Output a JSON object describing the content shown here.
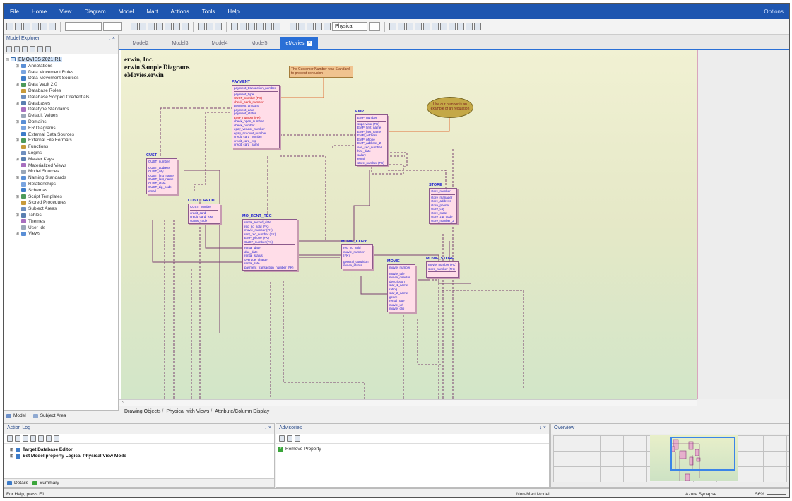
{
  "menu": [
    "File",
    "Home",
    "View",
    "Diagram",
    "Model",
    "Mart",
    "Actions",
    "Tools",
    "Help"
  ],
  "menu_right": "Options",
  "toolbar": {
    "notation_combo": "Physical"
  },
  "explorer": {
    "title": "Model Explorer",
    "root": "EMOVIES 2021 R1",
    "items": [
      "Annotations",
      "Data Movement Rules",
      "Data Movement Sources",
      "Data Vault 2.0",
      "Database Roles",
      "Database Scoped Credentials",
      "Databases",
      "Datatype Standards",
      "Default Values",
      "Domains",
      "ER Diagrams",
      "External Data Sources",
      "External File Formats",
      "Functions",
      "Logins",
      "Master Keys",
      "Materialized Views",
      "Model Sources",
      "Naming Standards",
      "Relationships",
      "Schemas",
      "Script Templates",
      "Stored Procedures",
      "Subject Areas",
      "Tables",
      "Themes",
      "User Ids",
      "Views"
    ],
    "tabs": [
      "Model",
      "Subject Area"
    ]
  },
  "doc_tabs": [
    "Model2",
    "Model3",
    "Model4",
    "Model5",
    "eMovies"
  ],
  "diagram": {
    "header": [
      "erwin, Inc.",
      "erwin Sample Diagrams",
      "eMovies.erwin"
    ],
    "note1": "The Customer Number was Standard to prevent confusion",
    "note2": "Use our number is an example of an regulation",
    "entities": [
      {
        "name": "PAYMENT",
        "pk": [
          "payment_transaction_number"
        ],
        "attrs": [
          {
            "t": "payment_type",
            "c": "b"
          },
          {
            "t": "CUST_number (FK)",
            "c": "r"
          },
          {
            "t": "check_bank_number",
            "c": "r"
          },
          {
            "t": "payment_amount",
            "c": "b"
          },
          {
            "t": "payment_date",
            "c": "b"
          },
          {
            "t": "payment_status",
            "c": "b"
          },
          {
            "t": "EMP_number (FK)",
            "c": "r"
          },
          {
            "t": "check_open_number",
            "c": "b"
          },
          {
            "t": "check_number",
            "c": "b"
          },
          {
            "t": "epay_vendor_number",
            "c": "b"
          },
          {
            "t": "epay_account_number",
            "c": "b"
          },
          {
            "t": "credit_card_number",
            "c": "b"
          },
          {
            "t": "credit_card_exp",
            "c": "b"
          },
          {
            "t": "credit_card_name",
            "c": "b"
          }
        ]
      },
      {
        "name": "EMP",
        "pk": [
          "EMP_number"
        ],
        "attrs": [
          {
            "t": "supervisor (FK)",
            "c": "b"
          },
          {
            "t": "EMP_first_name",
            "c": "b"
          },
          {
            "t": "EMP_last_name",
            "c": "b"
          },
          {
            "t": "EMP_address",
            "c": "b"
          },
          {
            "t": "EMP_phone",
            "c": "b"
          },
          {
            "t": "EMP_address_2",
            "c": "b"
          },
          {
            "t": "soc_sec_number",
            "c": "b"
          },
          {
            "t": "hire_date",
            "c": "b"
          },
          {
            "t": "salary",
            "c": "b"
          },
          {
            "t": "email",
            "c": "b"
          },
          {
            "t": "store_number (FK)",
            "c": "b"
          }
        ]
      },
      {
        "name": "CUST",
        "pk": [
          "CUST_number"
        ],
        "attrs": [
          {
            "t": "CUST_address",
            "c": "b"
          },
          {
            "t": "CUST_city",
            "c": "b"
          },
          {
            "t": "CUST_first_name",
            "c": "b"
          },
          {
            "t": "CUST_last_name",
            "c": "b"
          },
          {
            "t": "CUST_state",
            "c": "b"
          },
          {
            "t": "CUST_zip_code",
            "c": "b"
          },
          {
            "t": "email",
            "c": "b"
          }
        ]
      },
      {
        "name": "CUST_CREDIT",
        "pk": [
          "CUST_number"
        ],
        "attrs": [
          {
            "t": "credit_card",
            "c": "b"
          },
          {
            "t": "credit_card_exp",
            "c": "b"
          },
          {
            "t": "status_code",
            "c": "b"
          }
        ]
      },
      {
        "name": "MO_RENT_REC",
        "pk": [
          "rental_record_date",
          "rec_no_sold (FK)",
          "movie_number (FK)",
          "rent_rec_number (FK)",
          "EMP_phone (FK)",
          "CUST_number (FK)"
        ],
        "attrs": [
          {
            "t": "rental_date",
            "c": "b"
          },
          {
            "t": "due_date",
            "c": "b"
          },
          {
            "t": "rental_status",
            "c": "b"
          },
          {
            "t": "overdue_charge",
            "c": "b"
          },
          {
            "t": "rental_rate",
            "c": "b"
          },
          {
            "t": "payment_transaction_number (FK)",
            "c": "b"
          }
        ]
      },
      {
        "name": "STORE",
        "pk": [
          "store_number"
        ],
        "attrs": [
          {
            "t": "store_manager",
            "c": "b"
          },
          {
            "t": "store_address",
            "c": "b"
          },
          {
            "t": "store_phone",
            "c": "b"
          },
          {
            "t": "store_city",
            "c": "b"
          },
          {
            "t": "store_state",
            "c": "b"
          },
          {
            "t": "store_zip_code",
            "c": "b"
          },
          {
            "t": "store_number_2",
            "c": "b"
          }
        ]
      },
      {
        "name": "MOVIE_COPY",
        "pk": [
          "rec_no_sold",
          "movie_number (FK)"
        ],
        "attrs": [
          {
            "t": "general_condition",
            "c": "b"
          },
          {
            "t": "movie_status",
            "c": "b"
          }
        ]
      },
      {
        "name": "MOVIE_STORE",
        "pk": [
          "movie_number (FK)",
          "store_number (FK)"
        ],
        "attrs": []
      },
      {
        "name": "MOVIE",
        "pk": [
          "movie_number"
        ],
        "attrs": [
          {
            "t": "movie_title",
            "c": "b"
          },
          {
            "t": "movie_director",
            "c": "b"
          },
          {
            "t": "description",
            "c": "b"
          },
          {
            "t": "star_1_name",
            "c": "b"
          },
          {
            "t": "rating",
            "c": "b"
          },
          {
            "t": "star_2_name",
            "c": "b"
          },
          {
            "t": "genre",
            "c": "b"
          },
          {
            "t": "rental_rate",
            "c": "b"
          },
          {
            "t": "movie_url",
            "c": "b"
          },
          {
            "t": "movie_clip",
            "c": "b"
          }
        ]
      }
    ]
  },
  "view_tabs": [
    "Drawing Objects",
    "Physical with Views",
    "Attribute/Column Display"
  ],
  "action_log": {
    "title": "Action Log",
    "rows": [
      "Target Database Editor",
      "Set Model property Logical Physical View Mode"
    ],
    "tabs": [
      "Details",
      "Summary"
    ]
  },
  "advisories": {
    "title": "Advisories",
    "rows": [
      "Remove Property"
    ]
  },
  "overview": {
    "title": "Overview"
  },
  "panel_close": "↓ ×",
  "status": {
    "left": "For Help, press F1",
    "center": "Non-Mart Model",
    "db": "Azure Synapse",
    "zoom": "56%"
  }
}
